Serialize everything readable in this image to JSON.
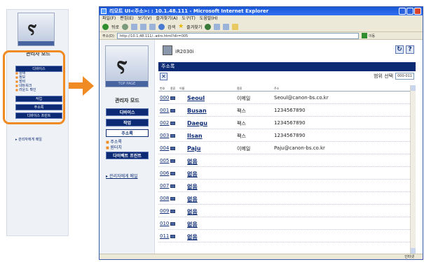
{
  "mini_nav": {
    "logo_tail": "TOP PAGE",
    "title": "관리자 모드",
    "buttons": [
      "디바이스",
      "작업",
      "주소록",
      "디바이스 프린트"
    ],
    "device_links": [
      "상태",
      "정보",
      "장비",
      "네트워크",
      "라운드 확인"
    ],
    "footer": "▸ 관리자에게 메일"
  },
  "window": {
    "title": "리모트 UI<주소>: : 10.1.48.111 - Microsoft Internet Explorer",
    "menu": [
      "파일(F)",
      "편집(E)",
      "보기(V)",
      "즐겨찾기(A)",
      "도구(T)",
      "도움말(H)"
    ],
    "toolbar": {
      "back": "뒤로",
      "search": "검색",
      "favorites": "즐겨찾기"
    },
    "address_label": "주소(D)",
    "address": "http://10.1.48.111/..adrs.html?dir=005",
    "go_label": "이동",
    "status_zone": "인터넷"
  },
  "nav": {
    "logo_tail": "TOP PAGE",
    "title": "관리자 모드",
    "buttons": {
      "device": "디바이스",
      "jobs": "작업",
      "address_book": "주소록",
      "direct_print": "다이렉트 프린트"
    },
    "sub_links": [
      "주소록",
      "원터치"
    ],
    "footer": "▸ 관리자에게 메일"
  },
  "main": {
    "device_name": "iR2030i",
    "section_title": "주소록",
    "range_label": "범위 선택",
    "range_value": "000-011",
    "headers": [
      "번호",
      "종류",
      "이름",
      "종류",
      "주소"
    ],
    "rows": [
      {
        "no": "000",
        "name": "Seoul",
        "type": "이메일",
        "addr": "Seoul@canon-bs.co.kr"
      },
      {
        "no": "001",
        "name": "Busan",
        "type": "팩스",
        "addr": "1234567890"
      },
      {
        "no": "002",
        "name": "Daegu",
        "type": "팩스",
        "addr": "1234567890"
      },
      {
        "no": "003",
        "name": "Ilsan",
        "type": "팩스",
        "addr": "1234567890"
      },
      {
        "no": "004",
        "name": "Paju",
        "type": "이메일",
        "addr": "Paju@canon-bs.co.kr"
      },
      {
        "no": "005",
        "name": "없음",
        "type": "",
        "addr": ""
      },
      {
        "no": "006",
        "name": "없음",
        "type": "",
        "addr": ""
      },
      {
        "no": "007",
        "name": "없음",
        "type": "",
        "addr": ""
      },
      {
        "no": "008",
        "name": "없음",
        "type": "",
        "addr": ""
      },
      {
        "no": "009",
        "name": "없음",
        "type": "",
        "addr": ""
      },
      {
        "no": "010",
        "name": "없음",
        "type": "",
        "addr": ""
      },
      {
        "no": "011",
        "name": "없음",
        "type": "",
        "addr": ""
      }
    ]
  },
  "colors": {
    "accent": "#f08a22",
    "nav_dark": "#0c2b74"
  }
}
